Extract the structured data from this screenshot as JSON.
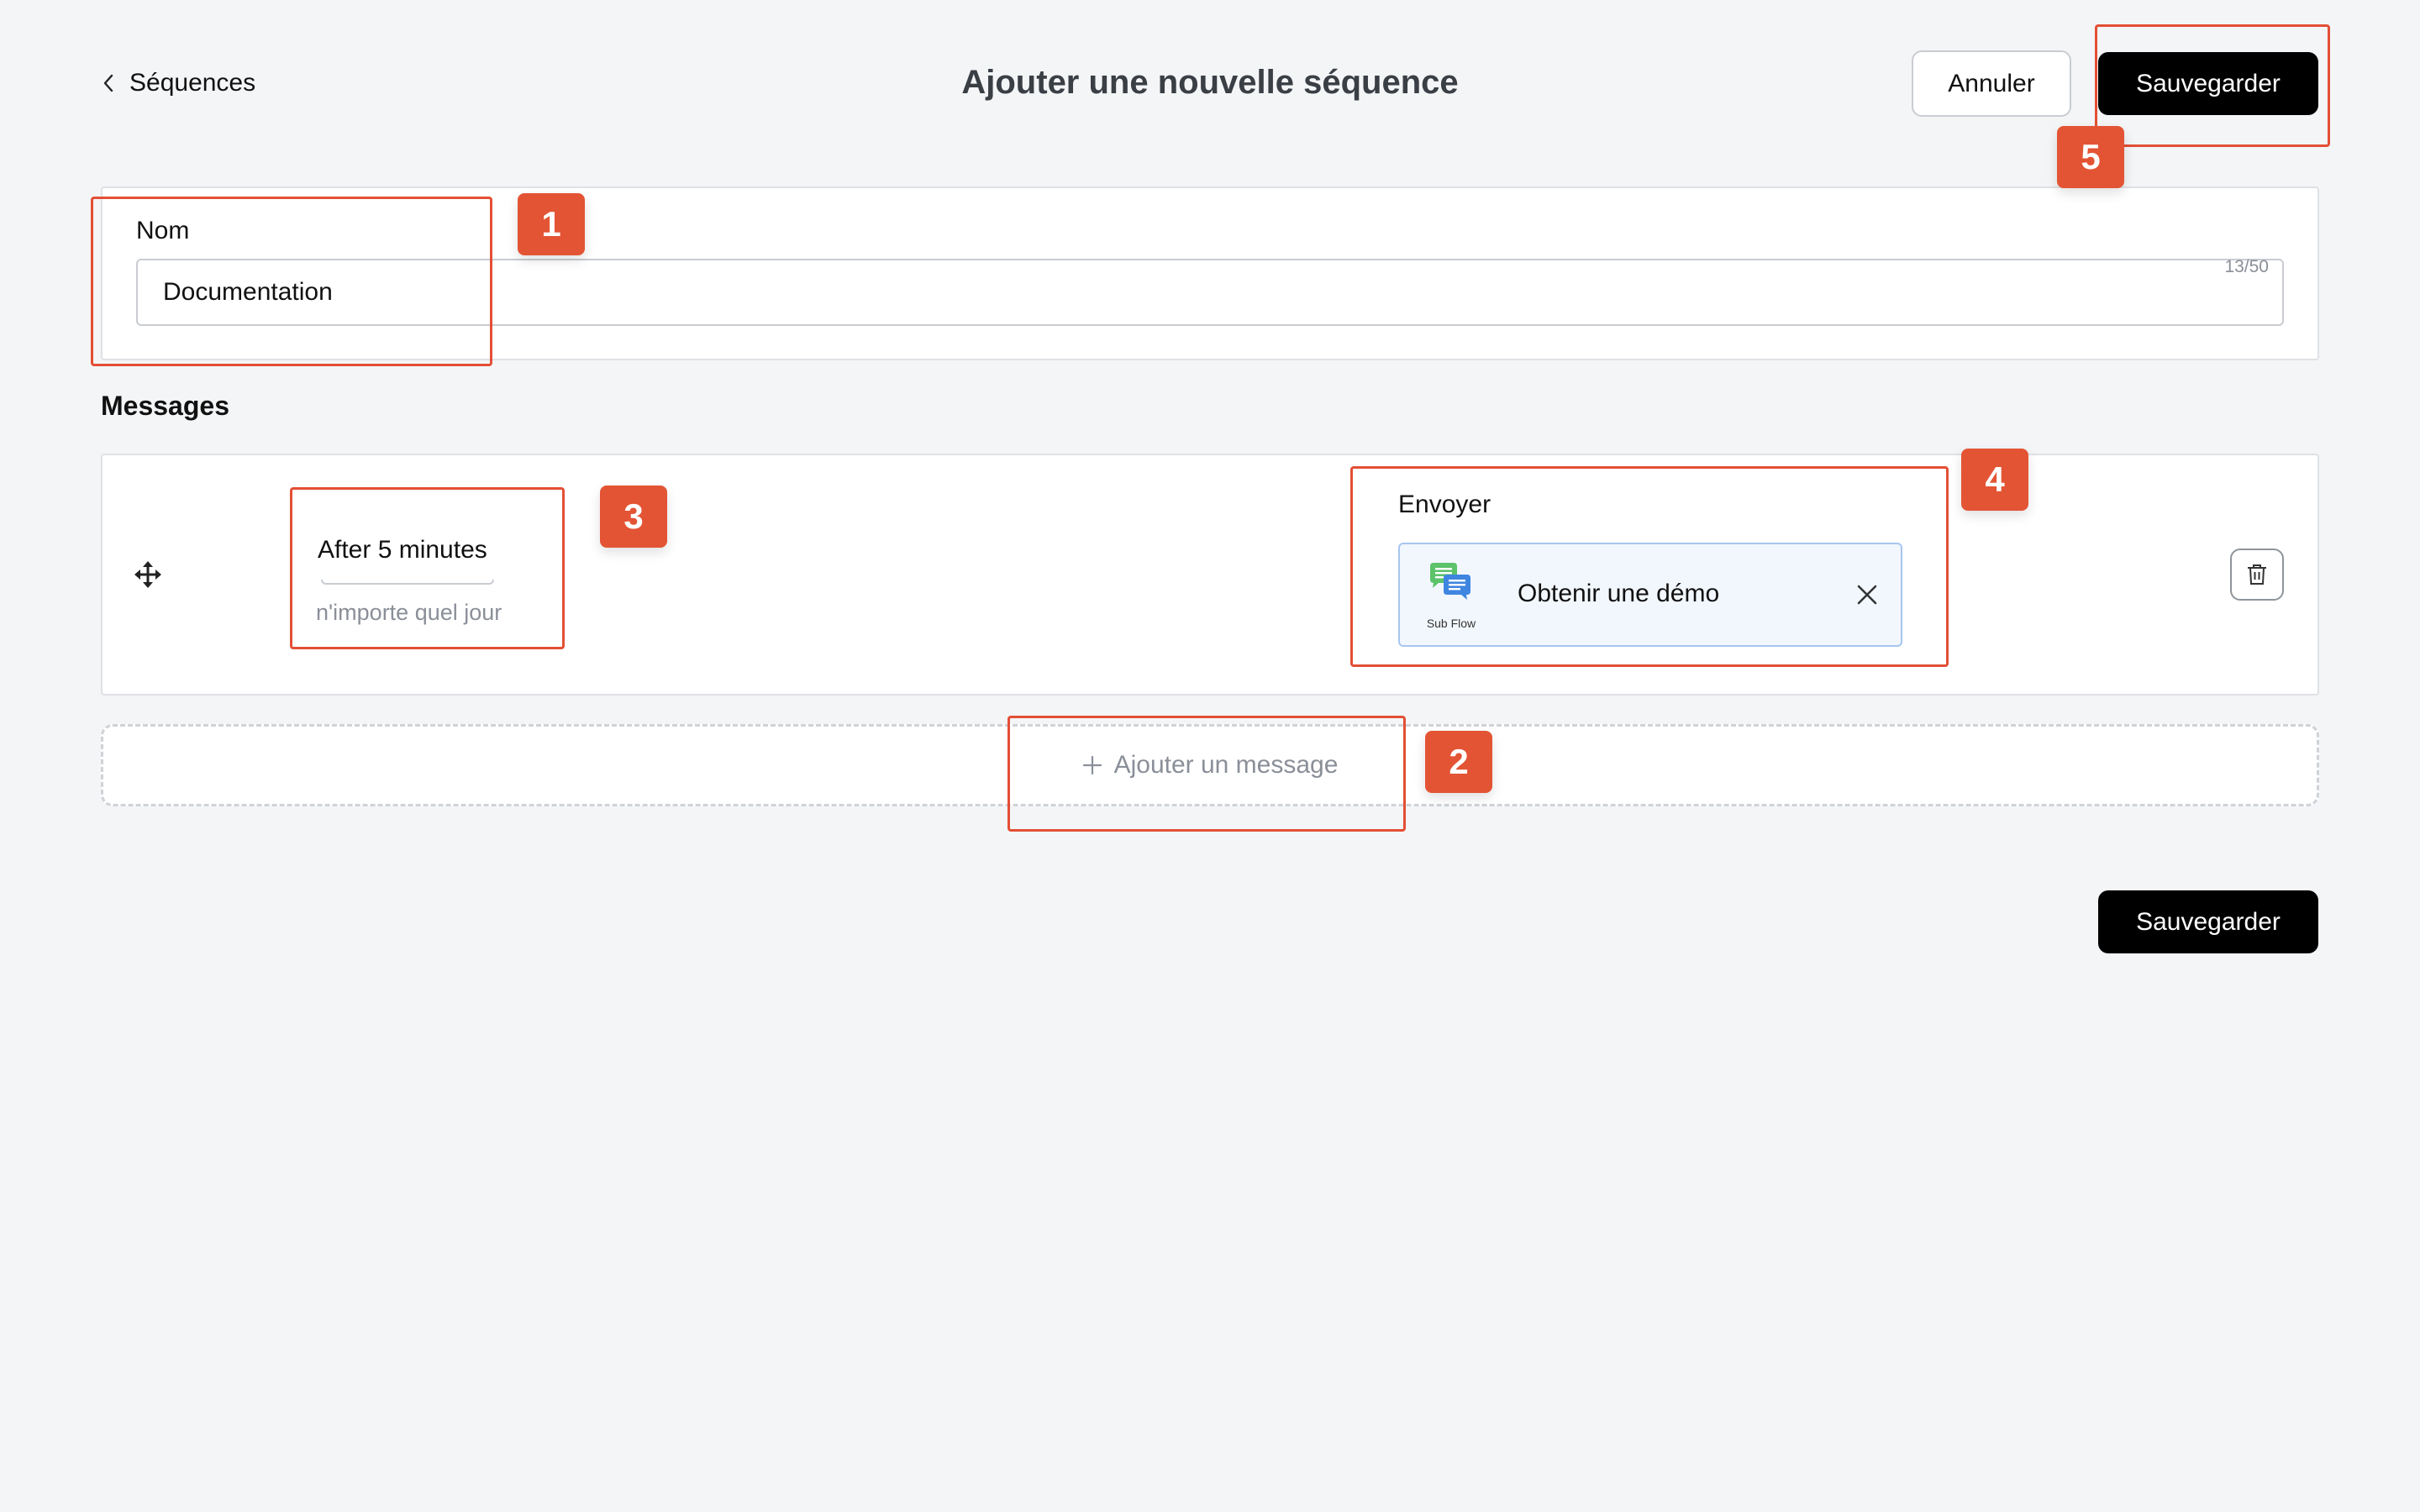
{
  "header": {
    "back_label": "Séquences",
    "title": "Ajouter une nouvelle séquence",
    "cancel_label": "Annuler",
    "save_label": "Sauvegarder"
  },
  "name_field": {
    "label": "Nom",
    "value": "Documentation",
    "char_count": "13/50"
  },
  "messages": {
    "section_title": "Messages",
    "items": [
      {
        "delay": "After 5 minutes",
        "day": "n'importe quel jour",
        "send_label": "Envoyer",
        "flow": {
          "type": "Sub Flow",
          "name": "Obtenir une démo"
        }
      }
    ],
    "add_label": "Ajouter un message"
  },
  "footer": {
    "save_label": "Sauvegarder"
  },
  "annotations": [
    "1",
    "2",
    "3",
    "4",
    "5"
  ],
  "colors": {
    "annotation": "#e34f35",
    "primary_button": "#000000",
    "flow_chip_bg": "#f2f7fe",
    "flow_chip_border": "#a8c6f0"
  }
}
